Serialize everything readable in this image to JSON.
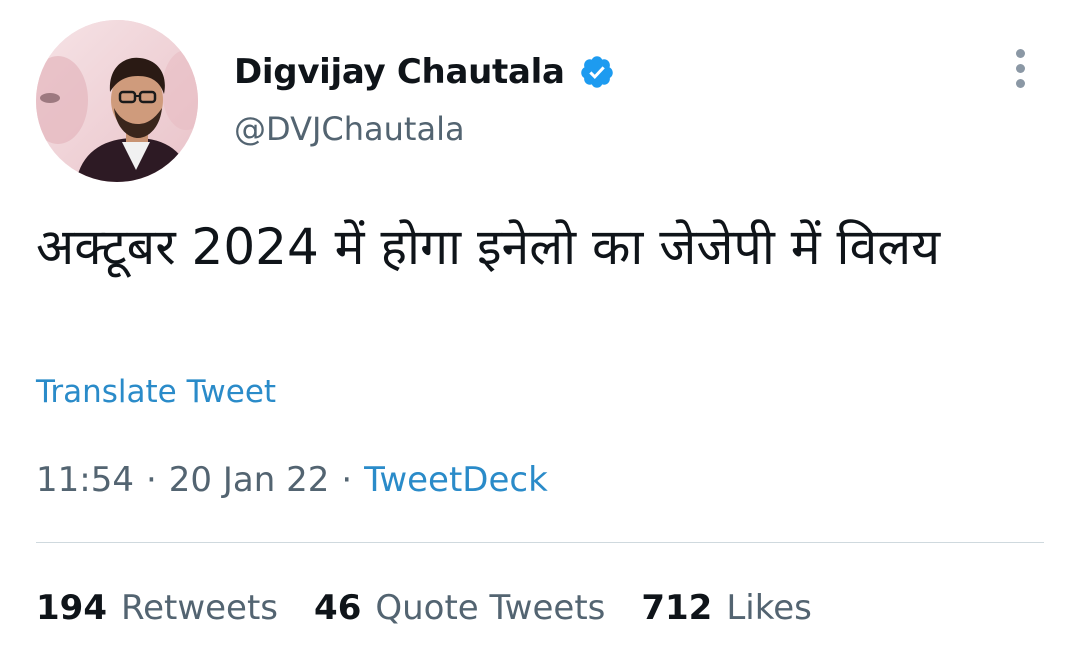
{
  "author": {
    "display_name": "Digvijay Chautala",
    "handle": "@DVJChautala",
    "verified": true
  },
  "tweet": {
    "text": "अक्टूबर 2024 में होगा इनेलो का जेजेपी में विलय",
    "translate_label": "Translate Tweet",
    "time": "11:54",
    "date": "20 Jan 22",
    "separator": "·",
    "source": "TweetDeck"
  },
  "stats": {
    "retweets": {
      "count": "194",
      "label": "Retweets"
    },
    "quote_tweets": {
      "count": "46",
      "label": "Quote Tweets"
    },
    "likes": {
      "count": "712",
      "label": "Likes"
    }
  },
  "colors": {
    "link": "#2a8bc9",
    "verified_badge": "#1d9bf0",
    "secondary_text": "#536471",
    "primary_text": "#0f1419",
    "divider": "#cfd9de"
  },
  "icons": {
    "verified": "verified-badge-icon",
    "more": "more-vertical-icon"
  }
}
